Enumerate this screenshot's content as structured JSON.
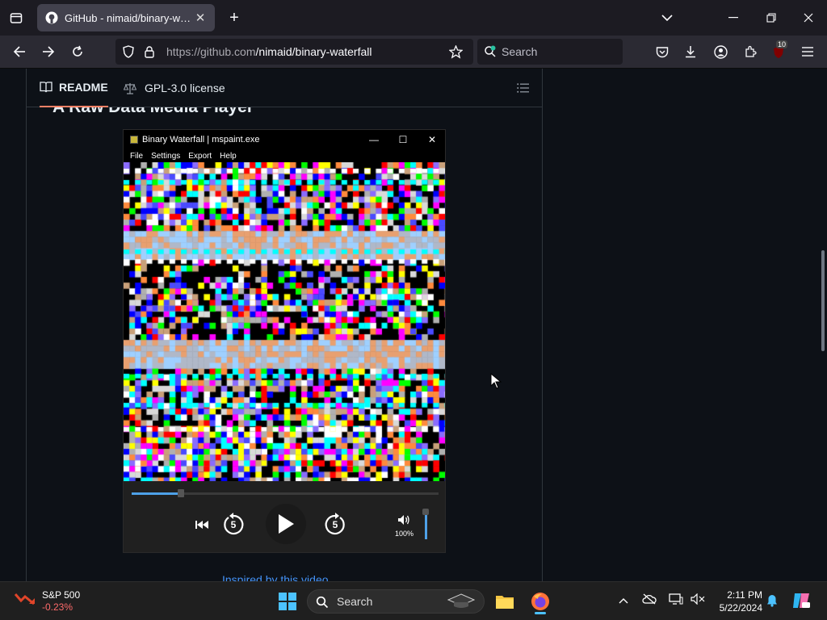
{
  "browser": {
    "tab_title": "GitHub - nimaid/binary-waterfall",
    "url_domain": "https://github.com",
    "url_path": "/nimaid/binary-waterfall",
    "search_placeholder": "Search",
    "extensions_badge": "10"
  },
  "readme": {
    "tab_readme": "README",
    "tab_license": "GPL-3.0 license",
    "heading": "A Raw Data Media Player",
    "inspired_link": "Inspired by this video"
  },
  "app": {
    "title": "Binary Waterfall | mspaint.exe",
    "menu": [
      "File",
      "Settings",
      "Export",
      "Help"
    ],
    "skip_back_label": "5",
    "skip_fwd_label": "5",
    "volume": "100%",
    "volume_level": 1.0,
    "seek_progress": 0.16
  },
  "taskbar": {
    "stock_name": "S&P 500",
    "stock_change": "-0.23%",
    "search_placeholder": "Search",
    "time": "2:11 PM",
    "date": "5/22/2024"
  },
  "colors": {
    "accent_blue": "#4ea1e8",
    "tab_underline": "#f78166",
    "link": "#4493f8"
  }
}
